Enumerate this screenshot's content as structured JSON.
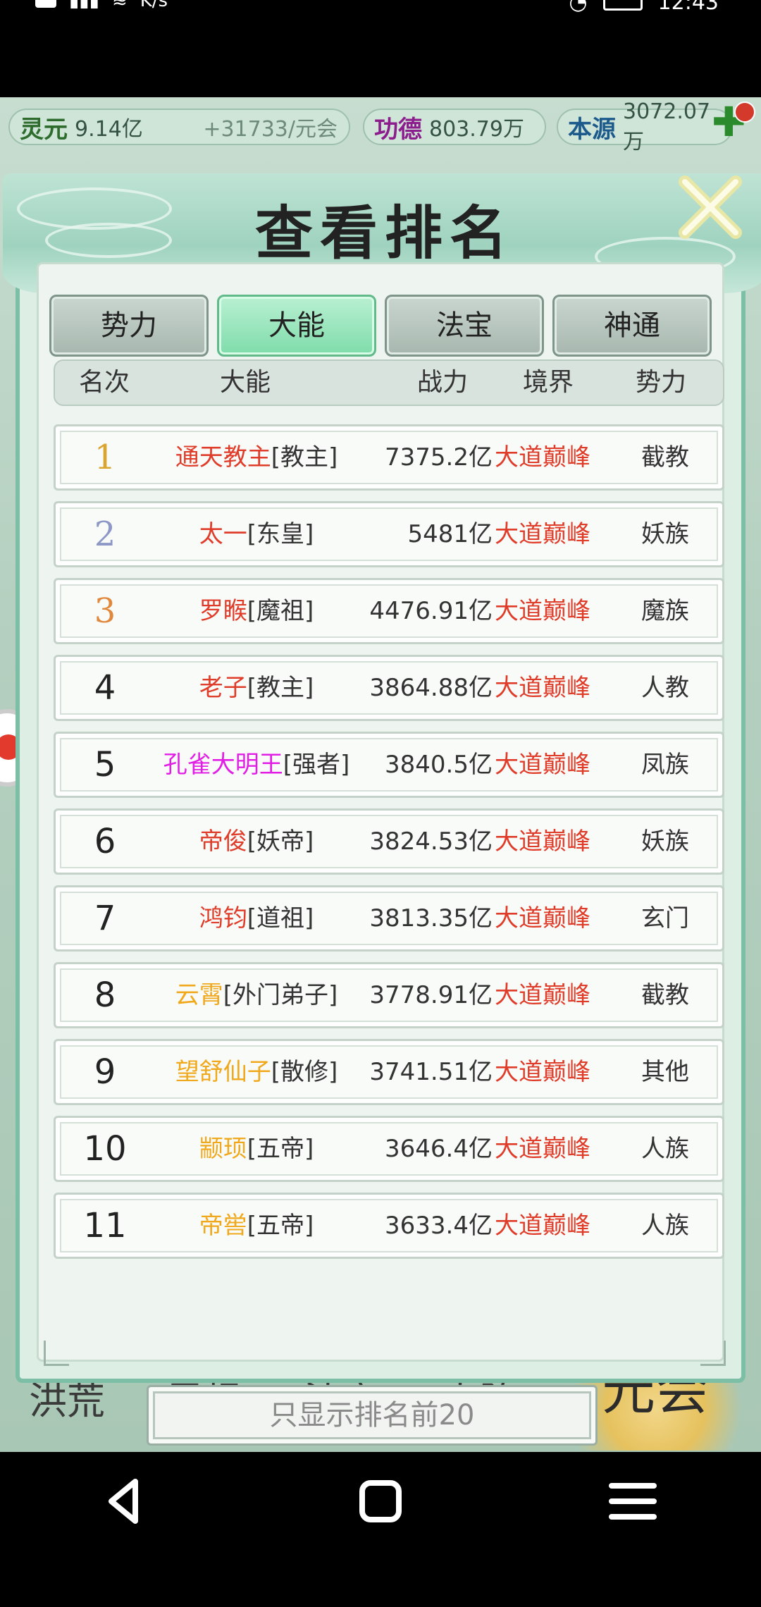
{
  "status_bar": {
    "net_speed": "K/s",
    "time": "12:43"
  },
  "resources": {
    "lingyuan": {
      "name": "灵元",
      "value": "9.14亿",
      "rate": "+31733/元会"
    },
    "gongde": {
      "name": "功德",
      "value": "803.79万"
    },
    "benyuan": {
      "name": "本源",
      "value": "3072.07万"
    }
  },
  "modal": {
    "title": "查看排名",
    "tabs": [
      {
        "label": "势力",
        "active": false
      },
      {
        "label": "大能",
        "active": true
      },
      {
        "label": "法宝",
        "active": false
      },
      {
        "label": "神通",
        "active": false
      }
    ],
    "columns": {
      "rank": "名次",
      "name": "大能",
      "power": "战力",
      "realm": "境界",
      "faction": "势力"
    },
    "rows": [
      {
        "rank": "1",
        "name": "通天教主",
        "title": "[教主]",
        "name_color": "#e03c2a",
        "power": "7375.2亿",
        "realm": "大道巅峰",
        "faction": "截教"
      },
      {
        "rank": "2",
        "name": "太一",
        "title": "[东皇]",
        "name_color": "#e03c2a",
        "power": "5481亿",
        "realm": "大道巅峰",
        "faction": "妖族"
      },
      {
        "rank": "3",
        "name": "罗睺",
        "title": "[魔祖]",
        "name_color": "#e03c2a",
        "power": "4476.91亿",
        "realm": "大道巅峰",
        "faction": "魔族"
      },
      {
        "rank": "4",
        "name": "老子",
        "title": "[教主]",
        "name_color": "#e03c2a",
        "power": "3864.88亿",
        "realm": "大道巅峰",
        "faction": "人教"
      },
      {
        "rank": "5",
        "name": "孔雀大明王",
        "title": "[强者]",
        "name_color": "#e21ee6",
        "power": "3840.5亿",
        "realm": "大道巅峰",
        "faction": "凤族"
      },
      {
        "rank": "6",
        "name": "帝俊",
        "title": "[妖帝]",
        "name_color": "#e03c2a",
        "power": "3824.53亿",
        "realm": "大道巅峰",
        "faction": "妖族"
      },
      {
        "rank": "7",
        "name": "鸿钧",
        "title": "[道祖]",
        "name_color": "#e03c2a",
        "power": "3813.35亿",
        "realm": "大道巅峰",
        "faction": "玄门"
      },
      {
        "rank": "8",
        "name": "云霄",
        "title": "[外门弟子]",
        "name_color": "#f0a81c",
        "power": "3778.91亿",
        "realm": "大道巅峰",
        "faction": "截教"
      },
      {
        "rank": "9",
        "name": "望舒仙子",
        "title": "[散修]",
        "name_color": "#f0a81c",
        "power": "3741.51亿",
        "realm": "大道巅峰",
        "faction": "其他"
      },
      {
        "rank": "10",
        "name": "颛顼",
        "title": "[五帝]",
        "name_color": "#f0a81c",
        "power": "3646.4亿",
        "realm": "大道巅峰",
        "faction": "人族"
      },
      {
        "rank": "11",
        "name": "帝喾",
        "title": "[五帝]",
        "name_color": "#f0a81c",
        "power": "3633.4亿",
        "realm": "大道巅峰",
        "faction": "人族"
      }
    ],
    "filter_button": "只显示排名前20"
  },
  "bottom_nav": [
    {
      "label": "洪荒"
    },
    {
      "label": "灵根"
    },
    {
      "label": "法宝"
    },
    {
      "label": "大阵"
    },
    {
      "label": "元会"
    }
  ],
  "system_nav": {
    "icons": [
      "back-icon",
      "home-icon",
      "menu-icon"
    ]
  },
  "colors": {
    "realm_red": "#e03c2a",
    "rank1": "#d9a52e",
    "rank2": "#8e98c6",
    "rank3": "#e0893e",
    "tab_active": "#7fdcaa"
  }
}
